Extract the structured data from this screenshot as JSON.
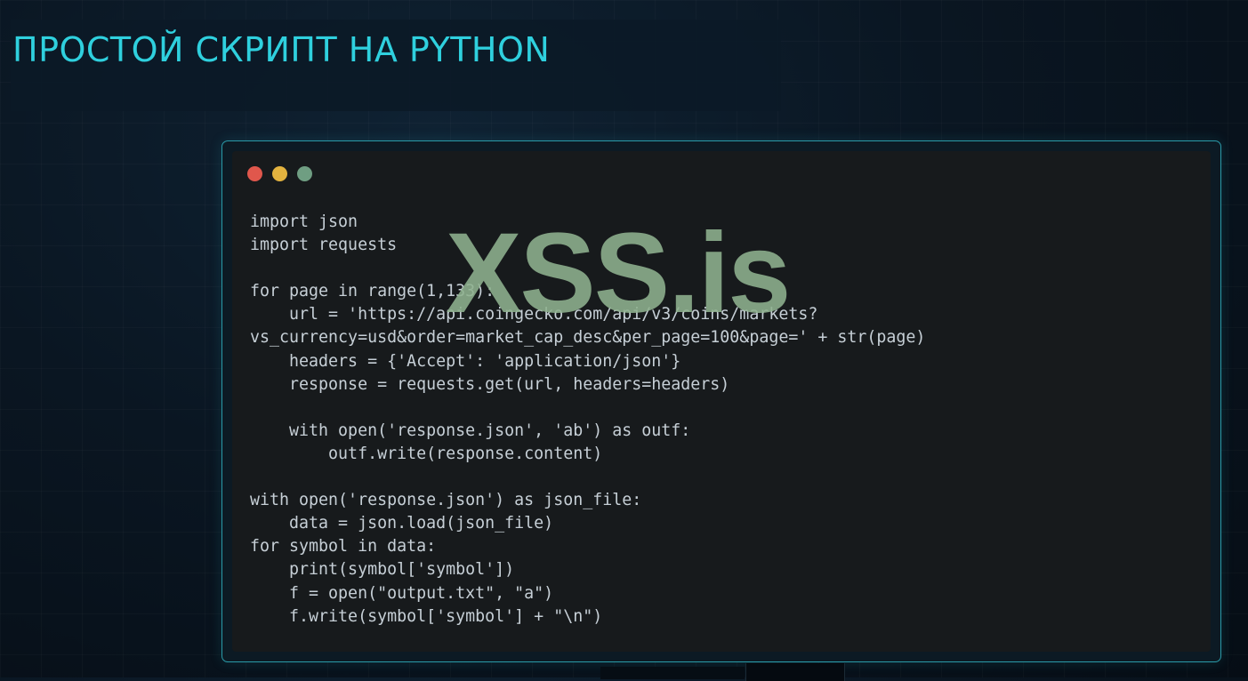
{
  "slide": {
    "title": "ПРОСТОЙ СКРИПТ НА PYTHON"
  },
  "code_window": {
    "lines": [
      "import json",
      "import requests",
      "",
      "for page in range(1,133):",
      "    url = 'https://api.coingecko.com/api/v3/coins/markets?",
      "vs_currency=usd&order=market_cap_desc&per_page=100&page=' + str(page)",
      "    headers = {'Accept': 'application/json'}",
      "    response = requests.get(url, headers=headers)",
      "",
      "    with open('response.json', 'ab') as outf:",
      "        outf.write(response.content)",
      "",
      "with open('response.json') as json_file:",
      "    data = json.load(json_file)",
      "for symbol in data:",
      "    print(symbol['symbol'])",
      "    f = open(\"output.txt\", \"a\")",
      "    f.write(symbol['symbol'] + \"\\n\")"
    ],
    "dots": [
      {
        "name": "red",
        "color": "#e0574c"
      },
      {
        "name": "yellow",
        "color": "#e3b33f"
      },
      {
        "name": "green",
        "color": "#6f9e82"
      }
    ]
  },
  "watermark": {
    "text": "XSS.is"
  }
}
